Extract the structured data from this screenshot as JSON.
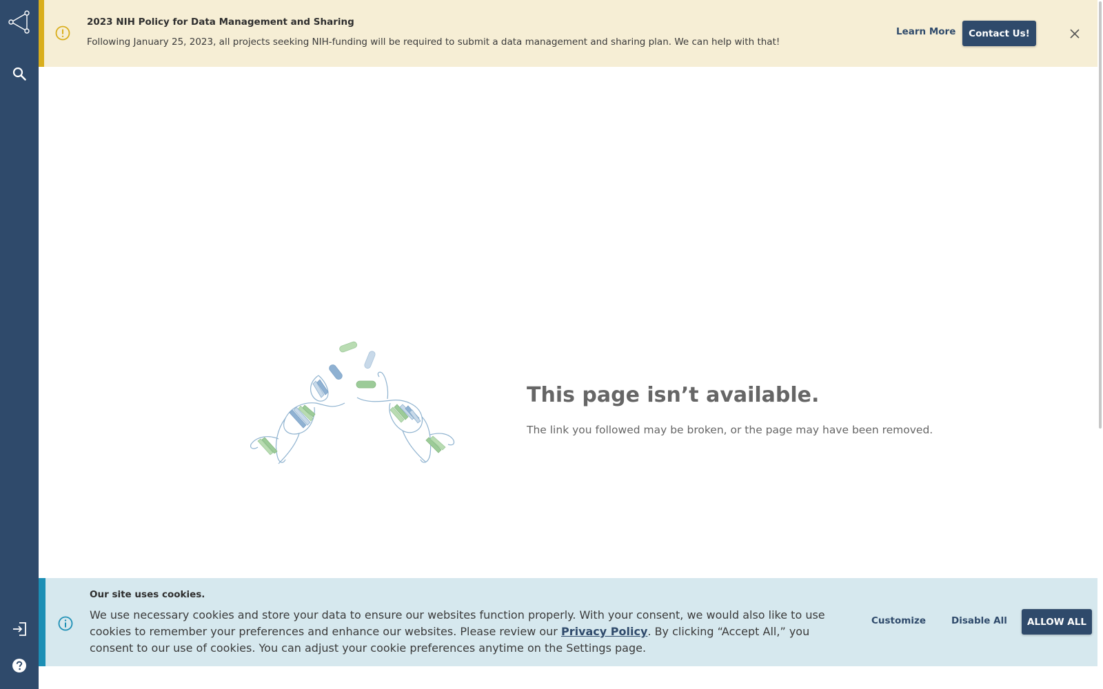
{
  "banner": {
    "title": "2023 NIH Policy for Data Management and Sharing",
    "text": "Following January 25, 2023, all projects seeking NIH-funding will be required to submit a data management and sharing plan. We can help with that!",
    "learn_more": "Learn More",
    "contact": "Contact Us!"
  },
  "error": {
    "title": "This page isn’t available.",
    "text": "The link you followed may be broken, or the page may have been removed."
  },
  "cookie": {
    "title": "Our site uses cookies.",
    "text_before": "We use necessary cookies and store your data to ensure our websites function properly. With your consent, we would also like to use cookies to remember your preferences and enhance our websites. Please review our ",
    "link": "Privacy Policy",
    "text_after": ". By clicking “Accept All,” you consent to our use of cookies. You can adjust your cookie preferences anytime on the Settings page.",
    "customize": "Customize",
    "disable_all": "Disable All",
    "allow_all": "ALLOW ALL"
  },
  "icons": {
    "logo": "network-share-icon",
    "search": "search-icon",
    "login": "login-icon",
    "help": "help-icon",
    "warning": "warning-icon",
    "info": "info-icon",
    "close": "close-icon"
  },
  "colors": {
    "sidebar": "#2f4a6b",
    "banner_bg": "#f6eed5",
    "banner_accent": "#d9ae1c",
    "cookie_bg": "#d6e8ee",
    "cookie_accent": "#1c8fb5",
    "primary_button": "#2f4a6b"
  }
}
